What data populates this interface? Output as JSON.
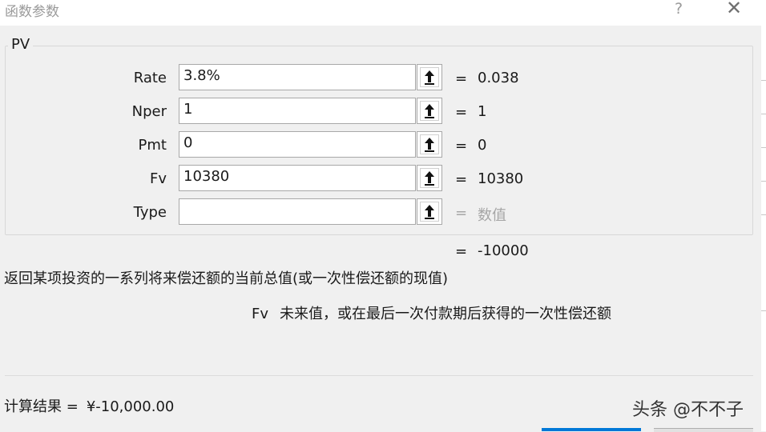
{
  "window": {
    "title": "函数参数",
    "help_label": "?",
    "close_label": "✕"
  },
  "function": {
    "name": "PV",
    "args": [
      {
        "label": "Rate",
        "input": "3.8%",
        "value": "0.038"
      },
      {
        "label": "Nper",
        "input": "1",
        "value": "1"
      },
      {
        "label": "Pmt",
        "input": "0",
        "value": "0"
      },
      {
        "label": "Fv",
        "input": "10380",
        "value": "10380"
      },
      {
        "label": "Type",
        "input": "",
        "value": "数值",
        "value_is_hint": true
      }
    ],
    "equals_sign": "=",
    "formula_result": "-10000",
    "description": "返回某项投资的一系列将来偿还额的当前总值(或一次性偿还额的现值)",
    "param_help_name": "Fv",
    "param_help_text": "未来值，或在最后一次付款期后获得的一次性偿还额"
  },
  "footer": {
    "result_label": "计算结果 =",
    "result_value": "¥-10,000.00"
  },
  "watermark": "头条 @不不子",
  "colors": {
    "dialog_bg": "#f0f0f0",
    "titlebar_bg": "#ffffff",
    "hint_text": "#a6a6a6",
    "ok_button_accent": "#0078d7"
  }
}
